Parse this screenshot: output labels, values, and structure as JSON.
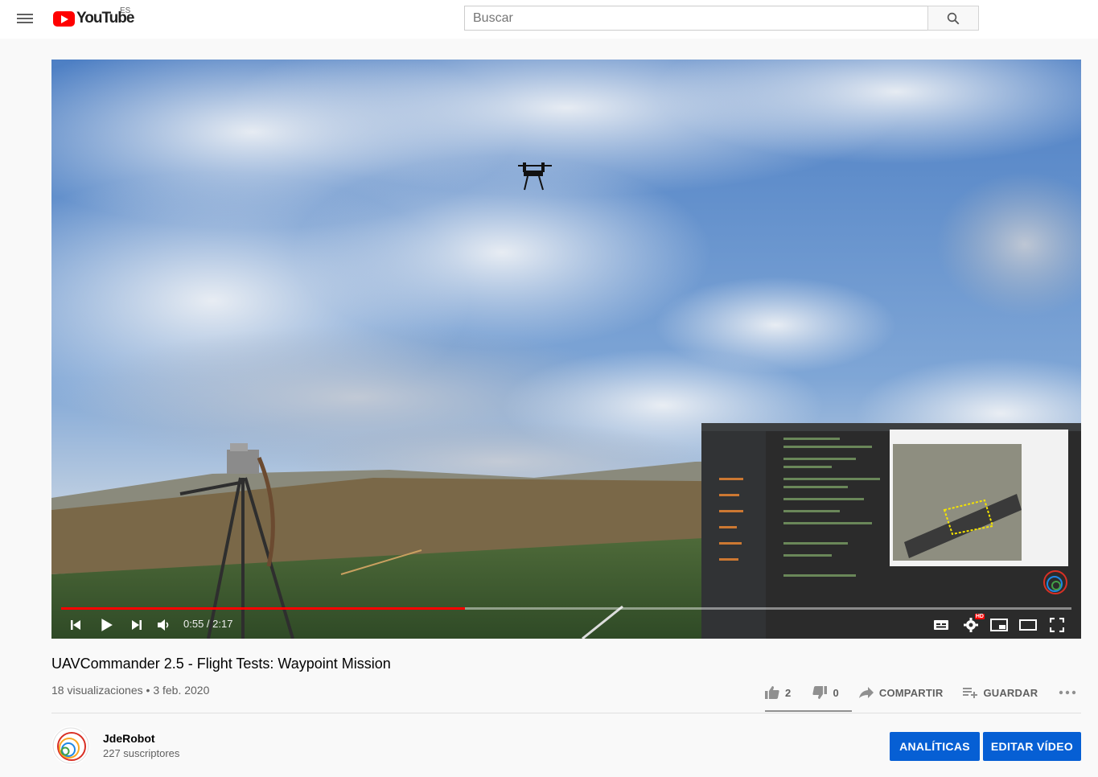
{
  "header": {
    "logo_text": "YouTube",
    "country_code": "ES",
    "search_placeholder": "Buscar"
  },
  "player": {
    "current_time": "0:55",
    "duration": "2:17",
    "time_display": "0:55 / 2:17",
    "progress_fraction": 0.4,
    "hd_badge": "HD"
  },
  "video": {
    "title": "UAVCommander 2.5 - Flight Tests: Waypoint Mission",
    "views": "18 visualizaciones",
    "separator": "•",
    "date": "3 feb. 2020",
    "meta_line": "18 visualizaciones • 3 feb. 2020"
  },
  "actions": {
    "likes": "2",
    "dislikes": "0",
    "share_label": "COMPARTIR",
    "save_label": "GUARDAR"
  },
  "channel": {
    "name": "JdeRobot",
    "subscribers": "227 suscriptores"
  },
  "buttons": {
    "analytics": "ANALÍTICAS",
    "edit_video": "EDITAR VÍDEO"
  },
  "colors": {
    "accent_red": "#ff0000",
    "primary_blue": "#065fd4",
    "text_secondary": "#606060"
  }
}
